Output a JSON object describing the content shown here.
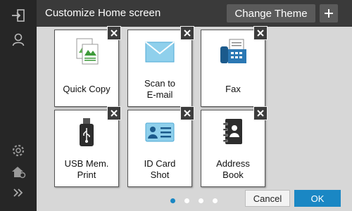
{
  "header": {
    "title": "Customize Home screen",
    "change_theme_label": "Change Theme",
    "add_label": "+"
  },
  "sidebar": {
    "items": [
      {
        "icon": "login-icon"
      },
      {
        "icon": "user-icon"
      },
      {
        "icon": "gear-icon"
      },
      {
        "icon": "home-settings-icon"
      },
      {
        "icon": "double-chevron-right-icon"
      }
    ]
  },
  "tiles": [
    {
      "label": "Quick Copy",
      "icon": "copy-icon"
    },
    {
      "label": "Scan to\nE-mail",
      "icon": "envelope-icon"
    },
    {
      "label": "Fax",
      "icon": "fax-icon"
    },
    {
      "label": "USB Mem.\nPrint",
      "icon": "usb-icon"
    },
    {
      "label": "ID Card\nShot",
      "icon": "id-card-icon"
    },
    {
      "label": "Address\nBook",
      "icon": "address-book-icon"
    }
  ],
  "pagination": {
    "pages": 4,
    "current": 1
  },
  "footer": {
    "cancel_label": "Cancel",
    "ok_label": "OK"
  },
  "colors": {
    "accent": "#1a87c4",
    "header_bg": "#3a3a3a",
    "sidebar_bg": "#262626",
    "content_bg": "#d7d7d7"
  }
}
